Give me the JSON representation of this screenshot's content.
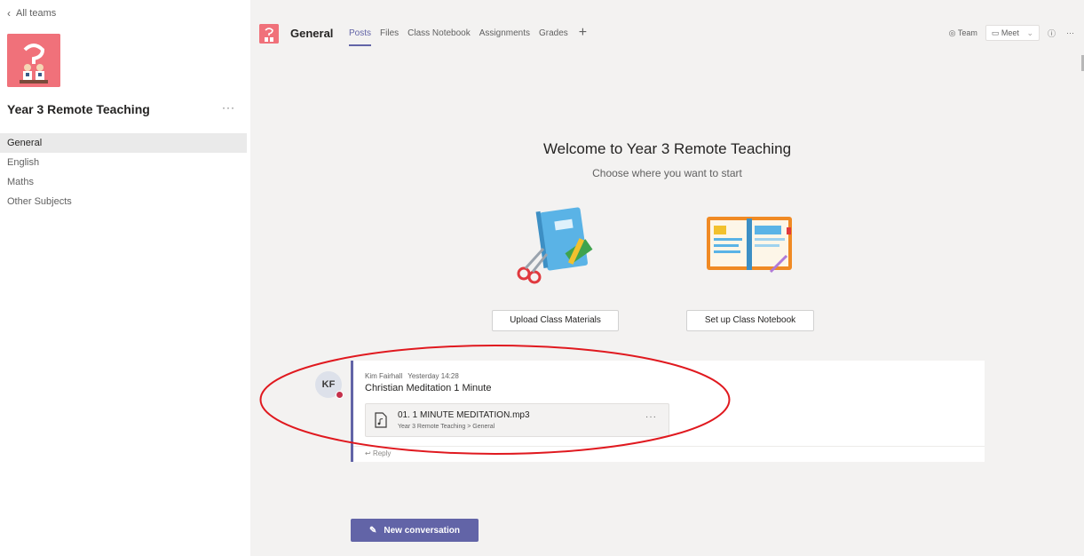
{
  "sidebar": {
    "back_label": "All teams",
    "team_name": "Year 3 Remote Teaching",
    "more_label": "···",
    "channels": [
      "General",
      "English",
      "Maths",
      "Other Subjects"
    ]
  },
  "header": {
    "channel": "General",
    "tabs": [
      "Posts",
      "Files",
      "Class Notebook",
      "Assignments",
      "Grades"
    ],
    "add_tab": "+",
    "team_label": "Team",
    "meet_label": "Meet",
    "info_label": "ⓘ",
    "more_label": "···"
  },
  "welcome": {
    "title": "Welcome to Year 3 Remote Teaching",
    "subtitle": "Choose where you want to start",
    "upload_button": "Upload Class Materials",
    "notebook_button": "Set up Class Notebook"
  },
  "post": {
    "initials": "KF",
    "author": "Kim Fairhall",
    "time": "Yesterday 14:28",
    "title": "Christian Meditation 1 Minute",
    "attachment_name": "01. 1 MINUTE MEDITATION.mp3",
    "attachment_path": "Year 3 Remote Teaching > General",
    "attachment_more": "···",
    "reply_label": "Reply"
  },
  "new_conversation": "New conversation",
  "colors": {
    "accent": "#6264a7",
    "team_avatar": "#f0717a",
    "annotation": "#e0191f",
    "status_busy": "#c4314b"
  },
  "icons": [
    "chevron-left-icon",
    "team-avatar-icon",
    "ellipsis-icon",
    "eye-icon",
    "video-camera-icon",
    "chevron-down-icon",
    "info-icon",
    "audio-file-icon",
    "reply-arrow-icon",
    "compose-icon"
  ]
}
